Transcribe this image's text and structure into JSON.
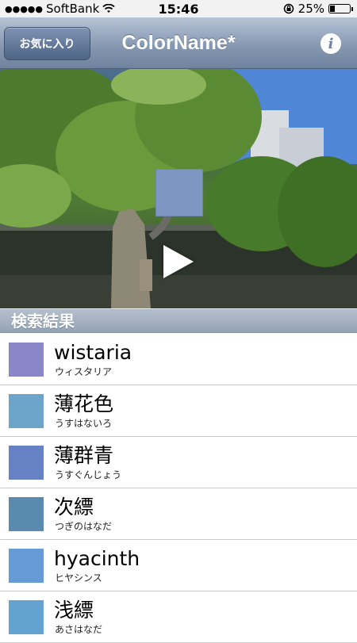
{
  "status_bar": {
    "signal": "●●●●●",
    "carrier": "SoftBank",
    "time": "15:46",
    "battery_percent": "25%",
    "battery_level": 0.25
  },
  "nav": {
    "favorites_label": "お気に入り",
    "title": "ColorName*",
    "info_label": "i"
  },
  "camera": {
    "sampled_color": "#7d97c2"
  },
  "section_header": "検索結果",
  "results": [
    {
      "name": "wistaria",
      "reading": "ウィスタリア",
      "color": "#8a87c8"
    },
    {
      "name": "薄花色",
      "reading": "うすはないろ",
      "color": "#6da4c9"
    },
    {
      "name": "薄群青",
      "reading": "うすぐんじょう",
      "color": "#6682c4"
    },
    {
      "name": "次縹",
      "reading": "つぎのはなだ",
      "color": "#5a8aae"
    },
    {
      "name": "hyacinth",
      "reading": "ヒヤシンス",
      "color": "#669bd8"
    },
    {
      "name": "浅縹",
      "reading": "あさはなだ",
      "color": "#64a3cf"
    }
  ]
}
